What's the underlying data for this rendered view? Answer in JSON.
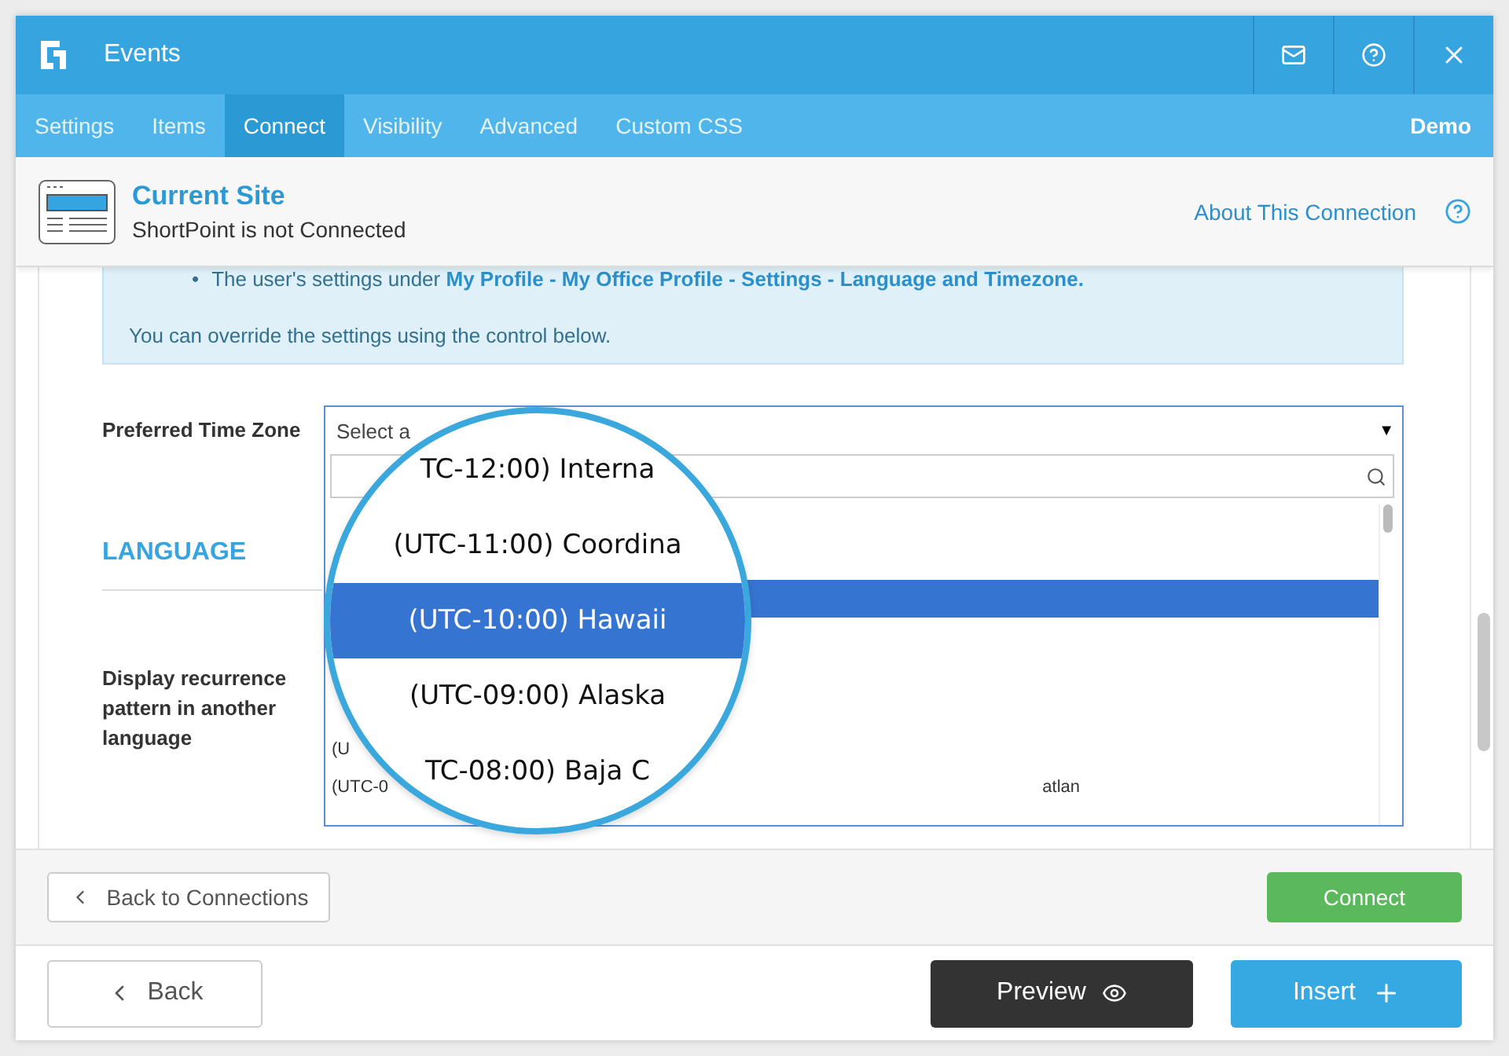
{
  "window": {
    "title": "Events"
  },
  "tabs": [
    {
      "label": "Settings",
      "selected": false
    },
    {
      "label": "Items",
      "selected": false
    },
    {
      "label": "Connect",
      "selected": true
    },
    {
      "label": "Visibility",
      "selected": false
    },
    {
      "label": "Advanced",
      "selected": false
    },
    {
      "label": "Custom CSS",
      "selected": false
    }
  ],
  "mode": "Demo",
  "site": {
    "title": "Current Site",
    "status": "ShortPoint is not Connected",
    "about_link": "About This Connection"
  },
  "info": {
    "marker": "•",
    "bullet": "The user's settings under **My Profile - My Office Profile - Settings - Language and Timezone.**",
    "note": "You can override the settings using the control below."
  },
  "timezone": {
    "label": "Preferred Time Zone",
    "placeholder": "Select a",
    "caret": "▼",
    "options": [
      {
        "label": "TC-12:00) Interna",
        "selected": false
      },
      {
        "label": "(UTC-11:00) Coordina",
        "selected": false
      },
      {
        "label": "(UTC-10:00) Hawaii",
        "selected": true
      },
      {
        "label": "(UTC-09:00) Alaska",
        "selected": false
      },
      {
        "label": "TC-08:00) Baja C",
        "selected": false
      }
    ],
    "partial_rows": [
      {
        "left": "(U"
      },
      {
        "left": "(UTC-0",
        "right": "atlan"
      }
    ]
  },
  "language": {
    "heading": "LANGUAGE",
    "label": "Display recurrence pattern in another language"
  },
  "footer": {
    "back_to_connections": "Back to Connections",
    "connect": "Connect",
    "back": "Back",
    "preview": "Preview",
    "insert": "Insert"
  }
}
